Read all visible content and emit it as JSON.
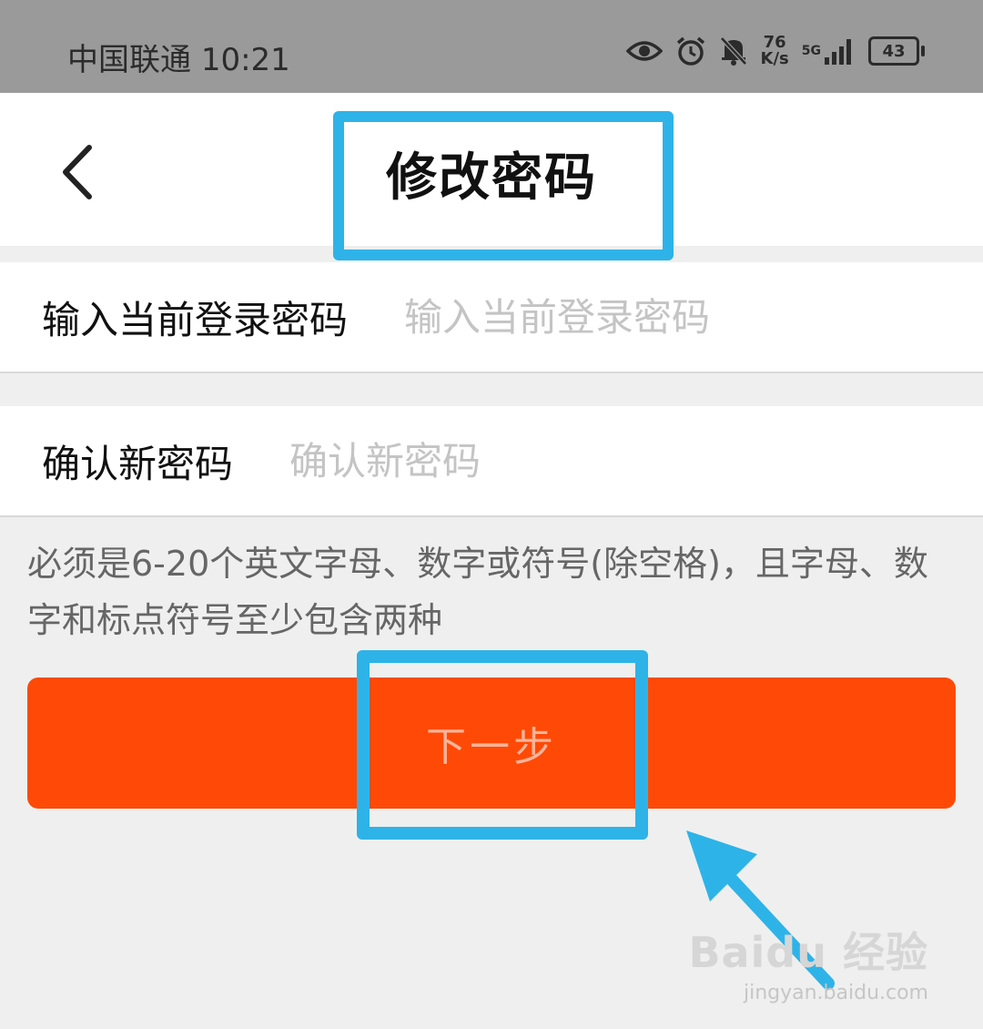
{
  "status_bar": {
    "carrier": "中国联通",
    "time": "10:21",
    "speed_value": "76",
    "speed_unit": "K/s",
    "network": "5G",
    "battery": "43"
  },
  "nav": {
    "title": "修改密码"
  },
  "form": {
    "current_password_label": "输入当前登录密码",
    "current_password_placeholder": "输入当前登录密码",
    "current_password_value": "",
    "confirm_password_label": "确认新密码",
    "confirm_password_placeholder": "确认新密码",
    "confirm_password_value": ""
  },
  "hint": "必须是6-20个英文字母、数字或符号(除空格)，且字母、数字和标点符号至少包含两种",
  "next_button": "下一步",
  "watermark": {
    "brand": "Baidu 经验",
    "url": "jingyan.baidu.com"
  },
  "colors": {
    "accent": "#ff4a07",
    "highlight": "#2eb3e8"
  }
}
